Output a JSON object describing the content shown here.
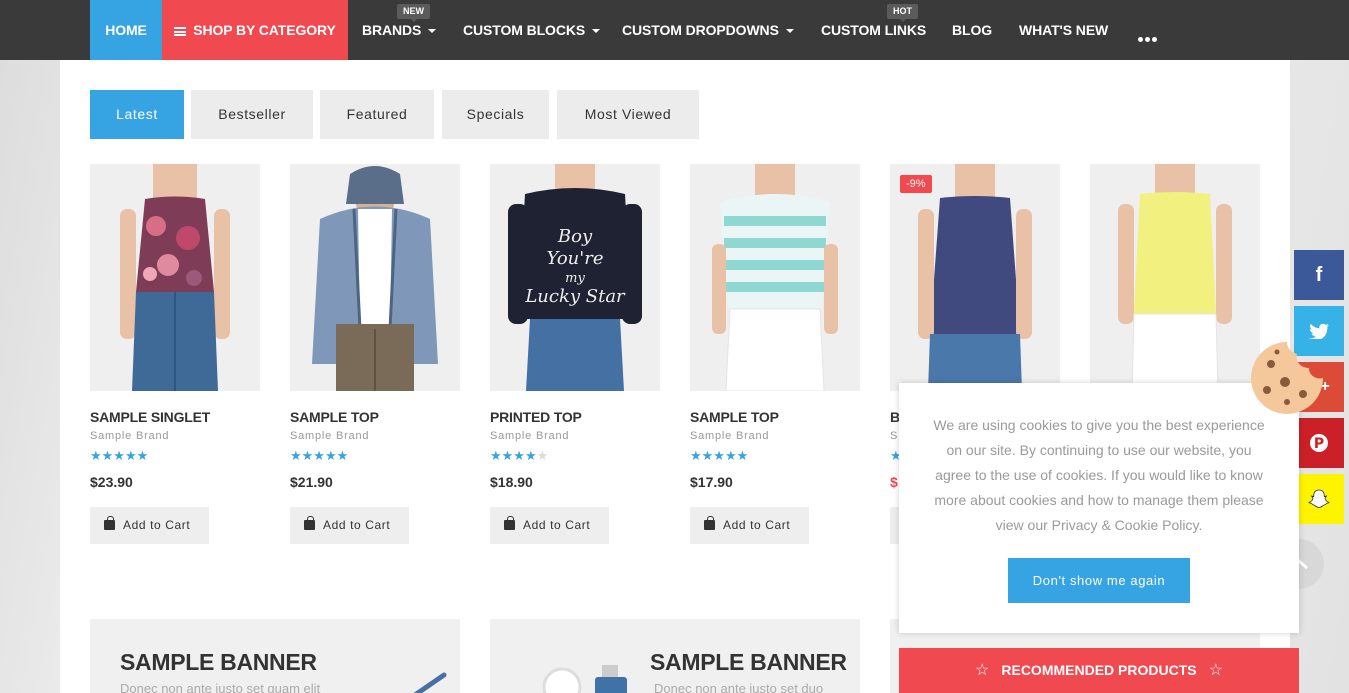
{
  "nav": {
    "home": "HOME",
    "shop_by_category": "SHOP BY CATEGORY",
    "brands": "BRANDS",
    "brands_badge": "NEW",
    "custom_blocks": "CUSTOM BLOCKS",
    "custom_dropdowns": "CUSTOM DROPDOWNS",
    "custom_links": "CUSTOM LINKS",
    "custom_links_badge": "HOT",
    "blog": "BLOG",
    "whats_new": "WHAT'S NEW"
  },
  "tabs": [
    "Latest",
    "Bestseller",
    "Featured",
    "Specials",
    "Most Viewed"
  ],
  "products": [
    {
      "name": "SAMPLE SINGLET",
      "brand": "Sample Brand",
      "rating": 5,
      "price": "$23.90",
      "cart": "Add to Cart"
    },
    {
      "name": "SAMPLE TOP",
      "brand": "Sample Brand",
      "rating": 5,
      "price": "$21.90",
      "cart": "Add to Cart"
    },
    {
      "name": "PRINTED TOP",
      "brand": "Sample Brand",
      "rating": 4,
      "price": "$18.90",
      "cart": "Add to Cart"
    },
    {
      "name": "SAMPLE TOP",
      "brand": "Sample Brand",
      "rating": 5,
      "price": "$17.90",
      "cart": "Add to Cart"
    },
    {
      "name": "B",
      "brand": "S",
      "rating": 1,
      "price": "$",
      "cart": "",
      "badge": "-9%"
    },
    {
      "name": "",
      "brand": "",
      "rating": 0,
      "price": "",
      "cart": ""
    }
  ],
  "shirt_text": "Boy You're my Lucky Star",
  "banners": [
    {
      "title": "SAMPLE BANNER",
      "text": "Donec non ante justo set quam elit"
    },
    {
      "title": "SAMPLE BANNER",
      "text": "Donec non ante justo set duo"
    }
  ],
  "cookie": {
    "text": "We are using cookies to give you the best experience on our site. By continuing to use our website, you agree to the use of cookies. If you would like to know more about cookies and how to manage them please view our Privacy & Cookie Policy.",
    "button": "Don't show me again"
  },
  "recommended": "RECOMMENDED PRODUCTS",
  "social": [
    "facebook",
    "twitter",
    "google-plus",
    "pinterest",
    "snapchat"
  ],
  "colors": {
    "accent": "#36a3e2",
    "sale": "#f04950",
    "nav": "#3a3a3a"
  }
}
